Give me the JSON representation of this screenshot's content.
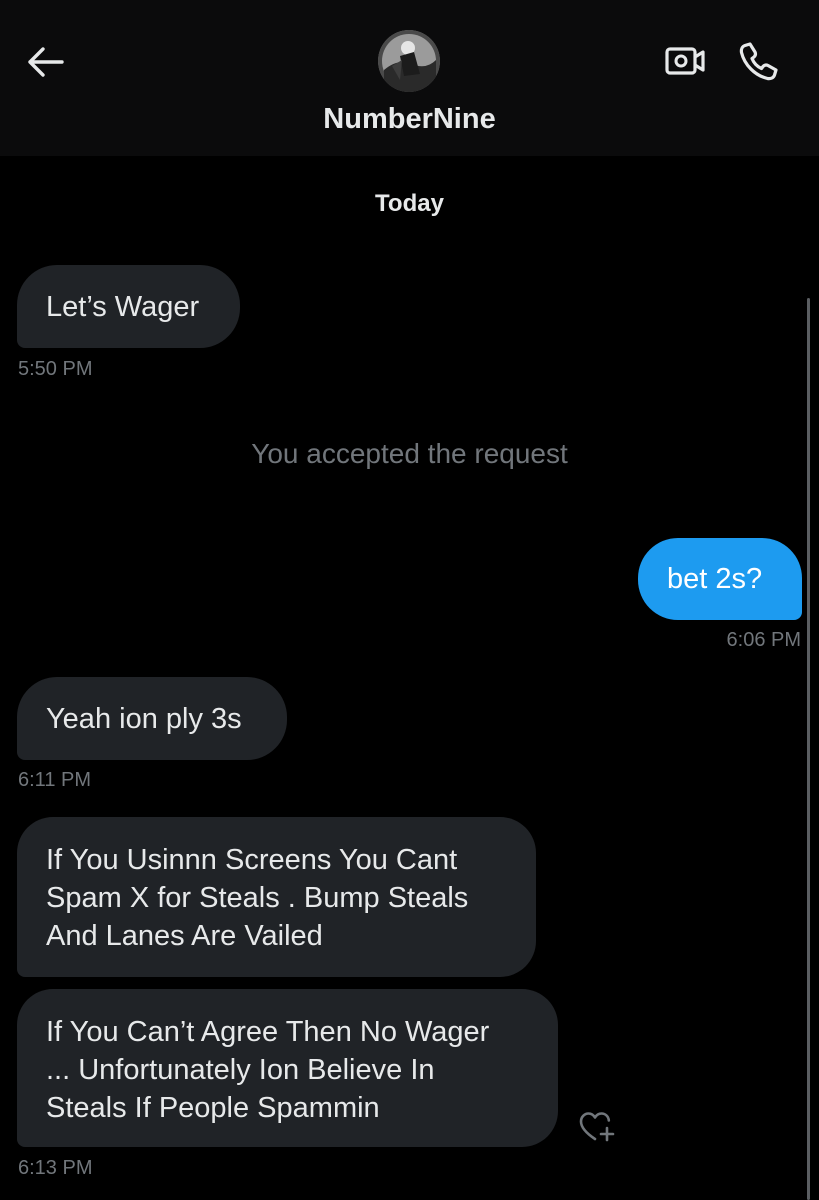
{
  "header": {
    "contact_name": "NumberNine",
    "back_icon": "arrow-left-icon",
    "video_icon": "video-camera-icon",
    "call_icon": "phone-icon"
  },
  "conversation": {
    "date_separator": "Today",
    "messages": [
      {
        "direction": "received",
        "text": "Let’s Wager",
        "time": "5:50 PM"
      },
      {
        "direction": "system",
        "text": "You accepted the request"
      },
      {
        "direction": "sent",
        "text": "bet 2s?",
        "time": "6:06 PM"
      },
      {
        "direction": "received",
        "text": "Yeah ion ply 3s",
        "time": "6:11 PM"
      },
      {
        "direction": "received",
        "lines": [
          "If You Usinnn Screens You Cant",
          "Spam X for Steals . Bump Steals",
          "And Lanes Are Vailed"
        ]
      },
      {
        "direction": "received",
        "lines": [
          "If You Can’t Agree Then No Wager",
          "... Unfortunately Ion Believe In",
          "Steals If People Spammin"
        ],
        "time": "6:13 PM"
      }
    ],
    "reaction_icon": "heart-plus-icon"
  },
  "colors": {
    "background": "#000000",
    "header_background": "#0b0b0c",
    "received_bubble": "#202327",
    "sent_bubble": "#1d9bf0",
    "secondary_text": "#71767b"
  }
}
